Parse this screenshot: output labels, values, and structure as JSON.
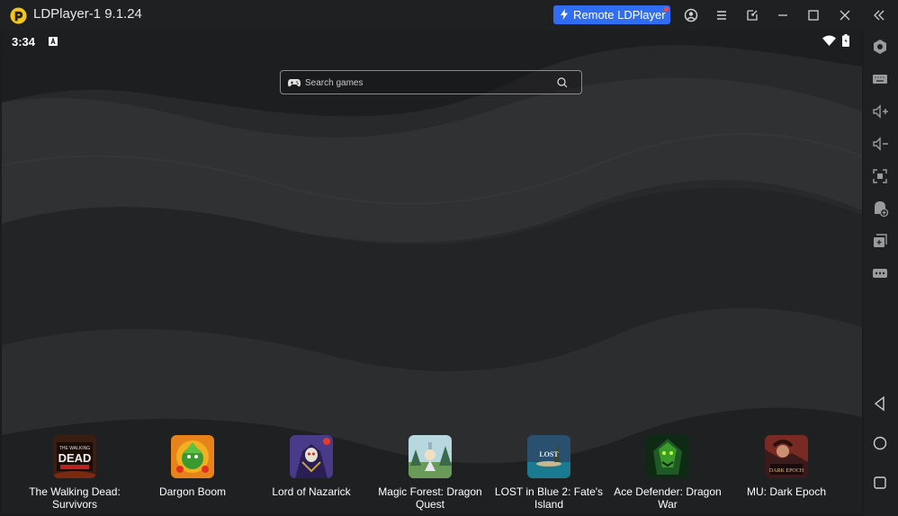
{
  "window": {
    "title": "LDPlayer-1 9.1.24",
    "remote_button": "Remote LDPlayer"
  },
  "status": {
    "time": "3:34"
  },
  "search": {
    "placeholder": "Search games"
  },
  "apps": [
    {
      "label": "The Walking Dead: Survivors"
    },
    {
      "label": "Dargon Boom"
    },
    {
      "label": "Lord of Nazarick"
    },
    {
      "label": "Magic Forest: Dragon Quest"
    },
    {
      "label": "LOST in Blue 2: Fate's Island"
    },
    {
      "label": "Ace Defender: Dragon War"
    },
    {
      "label": "MU: Dark Epoch"
    }
  ],
  "sidebar": [
    "settings-icon",
    "keyboard-icon",
    "volume-up-icon",
    "volume-down-icon",
    "screenshot-icon",
    "add-apk-icon",
    "multi-instance-icon",
    "more-icon",
    "back-icon",
    "home-icon",
    "recents-icon"
  ],
  "colors": {
    "accent": "#2f6ef2",
    "logo": "#f5c518",
    "background": "#1b1c1e"
  }
}
